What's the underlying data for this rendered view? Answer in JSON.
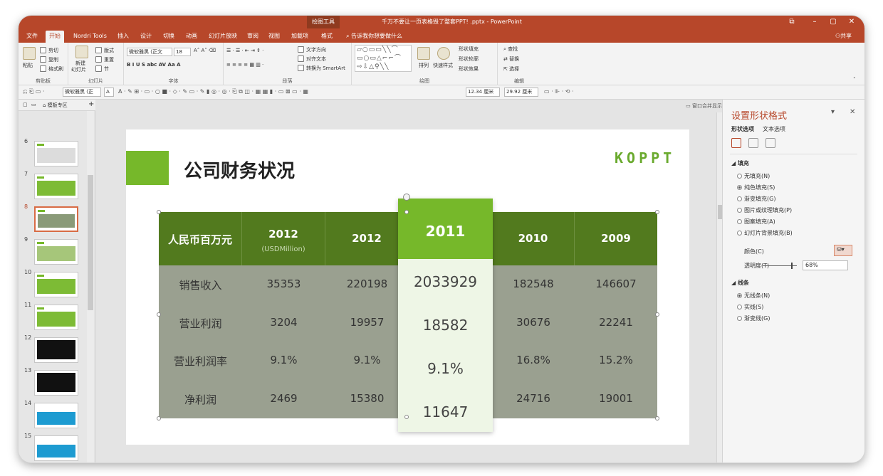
{
  "titlebar": {
    "context": "绘图工具",
    "document": "千万不要让一页表格毁了整套PPT! .pptx - PowerPoint",
    "restore_glyph": "⧉",
    "min_glyph": "–",
    "max_glyph": "▢",
    "close_glyph": "✕"
  },
  "tabs": [
    {
      "label": "文件"
    },
    {
      "label": "开始"
    },
    {
      "label": "Nordri Tools"
    },
    {
      "label": "插入"
    },
    {
      "label": "设计"
    },
    {
      "label": "切换"
    },
    {
      "label": "动画"
    },
    {
      "label": "幻灯片放映"
    },
    {
      "label": "审阅"
    },
    {
      "label": "视图"
    },
    {
      "label": "加载项"
    },
    {
      "label": "格式"
    }
  ],
  "tellme": "告诉我你想要做什么",
  "share": "共享",
  "ribbon": {
    "clipboard": {
      "paste": "粘贴",
      "cut": "剪切",
      "copy": "复制",
      "format_painter": "格式刷",
      "label": "剪贴板"
    },
    "slides": {
      "new": "新建",
      "new2": "幻灯片",
      "layout": "版式",
      "reset": "重置",
      "section": "节",
      "label": "幻灯片"
    },
    "font": {
      "name": "微软雅黑 (正文",
      "size": "18",
      "label": "字体",
      "row2": "B  I  U  S  abc  AV  Aa  A"
    },
    "paragraph": {
      "label": "段落",
      "direction": "文字方向",
      "align": "对齐文本",
      "smartart": "转换为 SmartArt"
    },
    "drawing": {
      "arrange": "排列",
      "quickstyle": "快速样式",
      "fill": "形状填充",
      "outline": "形状轮廓",
      "effect": "形状效果",
      "label": "绘图",
      "shapes_row1": "▱○▭▭╲╲⌒",
      "shapes_row2": "▭○▭△⌐⌐⌒",
      "shapes_row3": "⇨⇩△⚲╲╲"
    },
    "editing": {
      "find": "查找",
      "replace": "替换",
      "select": "选择",
      "label": "编辑"
    }
  },
  "qat": {
    "font": "微软雅黑 (正",
    "width": "12.34 厘米",
    "height": "29.92 厘米",
    "glyphs": "⎌  ⎗  ▭ ·",
    "a_box": "A",
    "tools": "A · ✎  ⊞ · ▭ · ○ ■ · ◇ · ✎ ▭ · ✎ ▮ ◎ · ◎ · ⎗ ⧉ ◫ · ▦ ▦ ▮ · ▭ ⊠ ▭ · ▦",
    "tools2": "▭ · ⊪ · ⟲ ·"
  },
  "thumbpane": {
    "tab": "模板专区"
  },
  "thumbs": [
    {
      "num": "6"
    },
    {
      "num": "7"
    },
    {
      "num": "8"
    },
    {
      "num": "9"
    },
    {
      "num": "10"
    },
    {
      "num": "11"
    },
    {
      "num": "12"
    },
    {
      "num": "13"
    },
    {
      "num": "14"
    },
    {
      "num": "15"
    }
  ],
  "canvas": {
    "window_merge": "窗口合并显示"
  },
  "slide": {
    "title": "公司财务状况",
    "logo": "KOPPT"
  },
  "table": {
    "header": [
      {
        "main": "人民币百万元",
        "sub": ""
      },
      {
        "main": "2012",
        "sub": "(USDMillion)"
      },
      {
        "main": "2012",
        "sub": ""
      },
      {
        "main": "2011",
        "sub": ""
      },
      {
        "main": "2010",
        "sub": ""
      },
      {
        "main": "2009",
        "sub": ""
      }
    ],
    "rows": [
      {
        "label": "销售收入",
        "c1": "35353",
        "c2": "220198",
        "c3": "2033929",
        "c4": "182548",
        "c5": "146607"
      },
      {
        "label": "营业利润",
        "c1": "3204",
        "c2": "19957",
        "c3": "18582",
        "c4": "30676",
        "c5": "22241"
      },
      {
        "label": "营业利润率",
        "c1": "9.1%",
        "c2": "9.1%",
        "c3": "9.1%",
        "c4": "16.8%",
        "c5": "15.2%"
      },
      {
        "label": "净利润",
        "c1": "2469",
        "c2": "15380",
        "c3": "11647",
        "c4": "24716",
        "c5": "19001"
      }
    ]
  },
  "pane": {
    "title": "设置形状格式",
    "tab_shape": "形状选项",
    "tab_text": "文本选项",
    "fill_section": "填充",
    "fill_options": [
      "无填充(N)",
      "纯色填充(S)",
      "渐变填充(G)",
      "图片或纹理填充(P)",
      "图案填充(A)",
      "幻灯片背景填充(B)"
    ],
    "color_label": "颜色(C)",
    "transparency_label": "透明度(T)",
    "transparency_value": "68%",
    "line_section": "线条",
    "line_options": [
      "无线条(N)",
      "实线(S)",
      "渐变线(G)"
    ],
    "pane_menu": "▾",
    "pane_close": "✕"
  },
  "colors": {
    "accent": "#b7472a",
    "green": "#76b82a",
    "dark_green": "#527a1e",
    "body_gray": "#9aa090"
  }
}
